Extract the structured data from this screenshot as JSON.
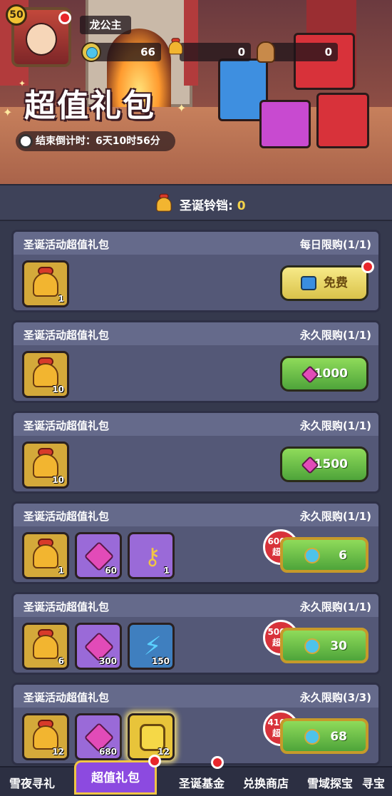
{
  "player": {
    "level": "50",
    "name": "龙公主"
  },
  "resources": {
    "diamonds": "66",
    "bells": "0",
    "cookies": "0"
  },
  "banner": {
    "title": "超值礼包",
    "countdown": "结束倒计时：6天10时56分"
  },
  "bell_bar": {
    "label": "圣诞铃铛: ",
    "value": "0"
  },
  "packs": [
    {
      "name": "圣诞活动超值礼包",
      "limit": "每日限购(1/1)",
      "items": [
        {
          "icon": "bell-icon",
          "qty": "1"
        }
      ],
      "button": {
        "type": "free",
        "label": "免费",
        "icon": "tv-icon"
      }
    },
    {
      "name": "圣诞活动超值礼包",
      "limit": "永久限购(1/1)",
      "items": [
        {
          "icon": "bell-icon",
          "qty": "10"
        }
      ],
      "button": {
        "type": "gem",
        "label": "1000",
        "icon": "gem-icon"
      }
    },
    {
      "name": "圣诞活动超值礼包",
      "limit": "永久限购(1/1)",
      "items": [
        {
          "icon": "bell-icon",
          "qty": "10"
        }
      ],
      "button": {
        "type": "gem",
        "label": "1500",
        "icon": "gem-icon"
      }
    },
    {
      "name": "圣诞活动超值礼包",
      "limit": "永久限购(1/1)",
      "badge": {
        "pct": "600%",
        "word": "超值"
      },
      "items": [
        {
          "icon": "bell-icon",
          "qty": "1"
        },
        {
          "icon": "gem-icon",
          "qty": "60"
        },
        {
          "icon": "key-icon",
          "qty": "1"
        }
      ],
      "button": {
        "type": "coin",
        "label": "6",
        "icon": "diamond-coin-icon"
      }
    },
    {
      "name": "圣诞活动超值礼包",
      "limit": "永久限购(1/1)",
      "badge": {
        "pct": "500%",
        "word": "超值"
      },
      "items": [
        {
          "icon": "bell-icon",
          "qty": "6"
        },
        {
          "icon": "gem-icon",
          "qty": "300"
        },
        {
          "icon": "energy-icon",
          "qty": "150"
        }
      ],
      "button": {
        "type": "coin",
        "label": "30",
        "icon": "diamond-coin-icon"
      }
    },
    {
      "name": "圣诞活动超值礼包",
      "limit": "永久限购(3/3)",
      "badge": {
        "pct": "410%",
        "word": "超值"
      },
      "items": [
        {
          "icon": "bell-icon",
          "qty": "12"
        },
        {
          "icon": "gem-icon",
          "qty": "680"
        },
        {
          "icon": "gold-coin-icon",
          "qty": "12"
        }
      ],
      "button": {
        "type": "coin",
        "label": "68",
        "icon": "diamond-coin-icon"
      }
    }
  ],
  "tabs": [
    "雪夜寻礼",
    "超值礼包",
    "圣诞基金",
    "兑换商店",
    "雪域探宝",
    "寻宝"
  ]
}
